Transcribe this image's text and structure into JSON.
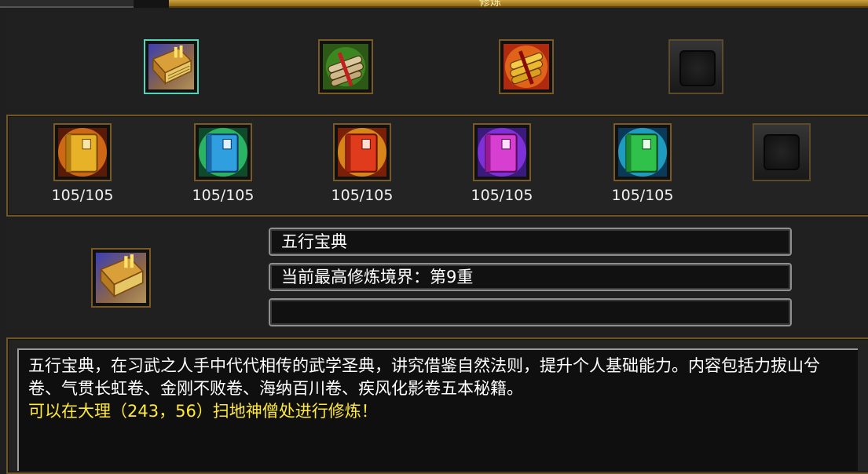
{
  "window": {
    "title": "修炼"
  },
  "top_slots": [
    {
      "name": "wuxing-baodian",
      "icon": "golden-book-stack-icon",
      "selected": true
    },
    {
      "name": "scroll-bundle",
      "icon": "scroll-bundle-icon",
      "selected": false
    },
    {
      "name": "golden-scroll-bundle",
      "icon": "gold-scroll-bundle-icon",
      "selected": false
    },
    {
      "name": "empty",
      "icon": "empty-slot-icon",
      "selected": false
    }
  ],
  "skill_books": [
    {
      "color": "#e8b228",
      "glow": "#ff8a1a",
      "count": "105/105",
      "icon": "yellow-book-icon"
    },
    {
      "color": "#2f9fe0",
      "glow": "#36e07a",
      "count": "105/105",
      "icon": "blue-book-icon"
    },
    {
      "color": "#e03b1c",
      "glow": "#ffb020",
      "count": "105/105",
      "icon": "red-book-icon"
    },
    {
      "color": "#d63fd0",
      "glow": "#9a3cff",
      "count": "105/105",
      "icon": "purple-book-icon"
    },
    {
      "color": "#2fc14a",
      "glow": "#26c4e8",
      "count": "105/105",
      "icon": "green-book-icon"
    }
  ],
  "info": {
    "name": "五行宝典",
    "realm": "当前最高修炼境界：第9重",
    "third": ""
  },
  "description": {
    "main": "五行宝典，在习武之人手中代代相传的武学圣典，讲究借鉴自然法则，提升个人基础能力。内容包括力拔山兮卷、气贯长虹卷、金刚不败卷、海纳百川卷、疾风化影卷五本秘籍。",
    "hint": "可以在大理（243，56）扫地神僧处进行修炼！"
  }
}
